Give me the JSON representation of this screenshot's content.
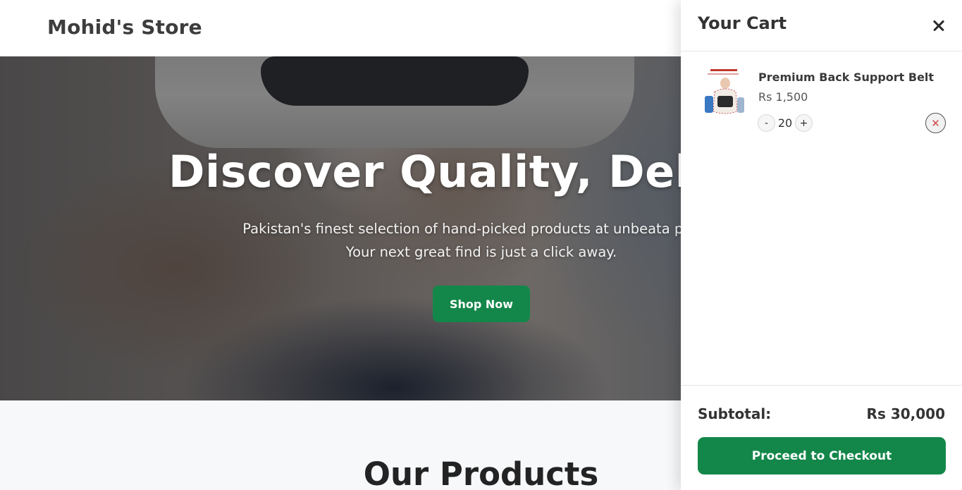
{
  "header": {
    "brand": "Mohid's Store"
  },
  "hero": {
    "title": "Discover Quality, Delive",
    "subtitle": "Pakistan's finest selection of hand-picked products at unbeata prices. Your next great find is just a click away.",
    "cta_label": "Shop Now"
  },
  "products": {
    "title": "Our Products"
  },
  "cart": {
    "title": "Your Cart",
    "close_icon": "close-icon",
    "items": [
      {
        "name": "Premium Back Support Belt",
        "price": "Rs 1,500",
        "quantity": "20",
        "minus_label": "-",
        "plus_label": "+",
        "remove_symbol": "✕"
      }
    ],
    "subtotal_label": "Subtotal:",
    "subtotal_value": "Rs 30,000",
    "checkout_label": "Proceed to Checkout"
  },
  "colors": {
    "accent": "#13874a",
    "remove_icon": "#d04a4a"
  }
}
